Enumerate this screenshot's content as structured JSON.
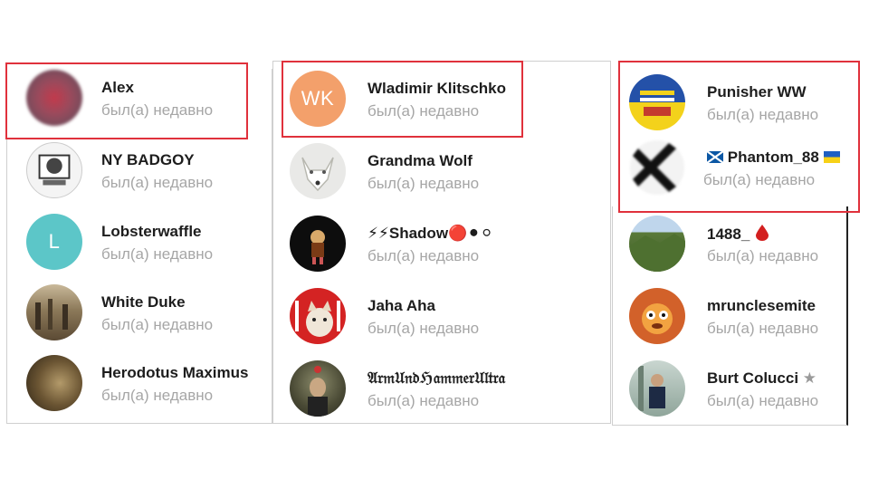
{
  "status_text": "был(а) недавно",
  "colors": {
    "highlight": "#e0313c",
    "status": "#a6a6a6",
    "wk_avatar": "#f3a06b",
    "l_avatar": "#5cc6c8"
  },
  "columns": [
    {
      "contacts": [
        {
          "name": "Alex",
          "status": "был(а) недавно",
          "avatar": "photo"
        },
        {
          "name": "NY BADGOY",
          "status": "был(а) недавно",
          "avatar": "photo"
        },
        {
          "name": "Lobsterwaffle",
          "status": "был(а) недавно",
          "avatar": "initials",
          "initials": "L"
        },
        {
          "name": "White Duke",
          "status": "был(а) недавно",
          "avatar": "photo"
        },
        {
          "name": "Herodotus Maximus",
          "status": "был(а) недавно",
          "avatar": "photo"
        }
      ]
    },
    {
      "contacts": [
        {
          "name": "Wladimir Klitschko",
          "status": "был(а) недавно",
          "avatar": "initials",
          "initials": "WK"
        },
        {
          "name": "Grandma Wolf",
          "status": "был(а) недавно",
          "avatar": "photo"
        },
        {
          "name": "⚡⚡Shadow🔴⚫⚪",
          "status": "был(а) недавно",
          "avatar": "photo"
        },
        {
          "name": "Jaha Aha",
          "status": "был(а) недавно",
          "avatar": "photo"
        },
        {
          "name": "𝔄𝔯𝔪𝔘𝔫𝔡ℌ𝔞𝔪𝔪𝔢𝔯𝔘𝔩𝔱𝔯𝔞",
          "status": "был(а) недавно",
          "avatar": "photo"
        }
      ]
    },
    {
      "contacts": [
        {
          "name": "Punisher WW",
          "status": "был(а) недавно",
          "avatar": "photo"
        },
        {
          "name": "Phantom_88",
          "status": "был(а) недавно",
          "avatar": "photo",
          "flag_left": "scotland-flag-icon",
          "flag_right": "ukraine-flag-icon"
        },
        {
          "name": "1488_",
          "status": "был(а) недавно",
          "avatar": "photo",
          "badge": "blood-drop-icon"
        },
        {
          "name": "mrunclesemite",
          "status": "был(а) недавно",
          "avatar": "photo"
        },
        {
          "name": "Burt Colucci",
          "status": "был(а) недавно",
          "avatar": "photo",
          "badge": "star-icon"
        }
      ]
    }
  ]
}
